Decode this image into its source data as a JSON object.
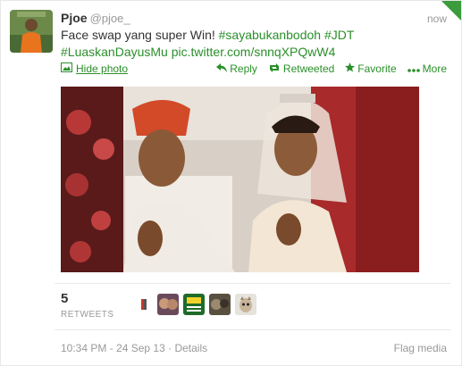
{
  "tweet": {
    "author_name": "Pjoe",
    "screen_name": "@pjoe_",
    "time": "now",
    "text_plain": "Face swap yang super Win!",
    "hashtag1": "#sayabukanbodoh",
    "hashtag2": "#JDT",
    "hashtag3": "#LuaskanDayusMu",
    "pic_link": "pic.twitter.com/snnqXPQwW4"
  },
  "media": {
    "hide_label": "Hide photo"
  },
  "actions": {
    "reply": "Reply",
    "retweeted": "Retweeted",
    "favorite": "Favorite",
    "more": "More"
  },
  "stats": {
    "retweet_count": "5",
    "retweet_label": "RETWEETS"
  },
  "footer": {
    "timestamp": "10:34 PM - 24 Sep 13",
    "separator": "·",
    "details": "Details",
    "flag": "Flag media"
  },
  "colors": {
    "accent": "#2a8f2a",
    "muted": "#999999",
    "corner": "#3c9b3c"
  }
}
